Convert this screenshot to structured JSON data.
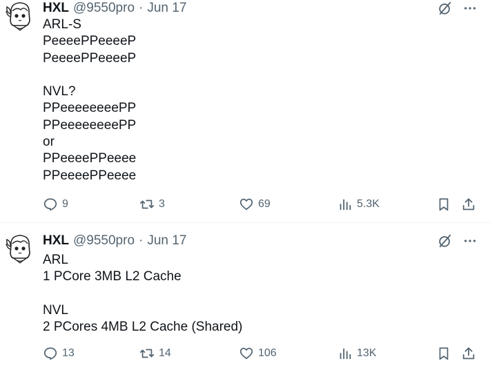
{
  "tweets": [
    {
      "author_name": "HXL",
      "handle": "@9550pro",
      "separator": "·",
      "date": "Jun 17",
      "lines": [
        "ARL-S",
        "PeeeePPeeeeP",
        "PeeeePPeeeeP",
        "",
        "NVL?",
        "PPeeeeeeeePP",
        "PPeeeeeeeePP",
        "or",
        "PPeeeePPeeee",
        "PPeeeePPeeee"
      ],
      "replies": "9",
      "retweets": "3",
      "likes": "69",
      "views": "5.3K"
    },
    {
      "author_name": "HXL",
      "handle": "@9550pro",
      "separator": "·",
      "date": "Jun 17",
      "lines": [
        "ARL",
        "1 PCore 3MB L2 Cache",
        "",
        "NVL",
        "2 PCores 4MB L2 Cache (Shared)"
      ],
      "replies": "13",
      "retweets": "14",
      "likes": "106",
      "views": "13K"
    }
  ],
  "icons": {
    "grok": "grok-slash-icon",
    "more": "more-dots-icon",
    "reply": "reply-bubble-icon",
    "retweet": "retweet-arrows-icon",
    "like": "heart-icon",
    "views": "bar-chart-icon",
    "bookmark": "bookmark-icon",
    "share": "share-upload-icon"
  },
  "colors": {
    "text": "#0f1419",
    "muted": "#536471",
    "divider": "#eff3f4"
  }
}
